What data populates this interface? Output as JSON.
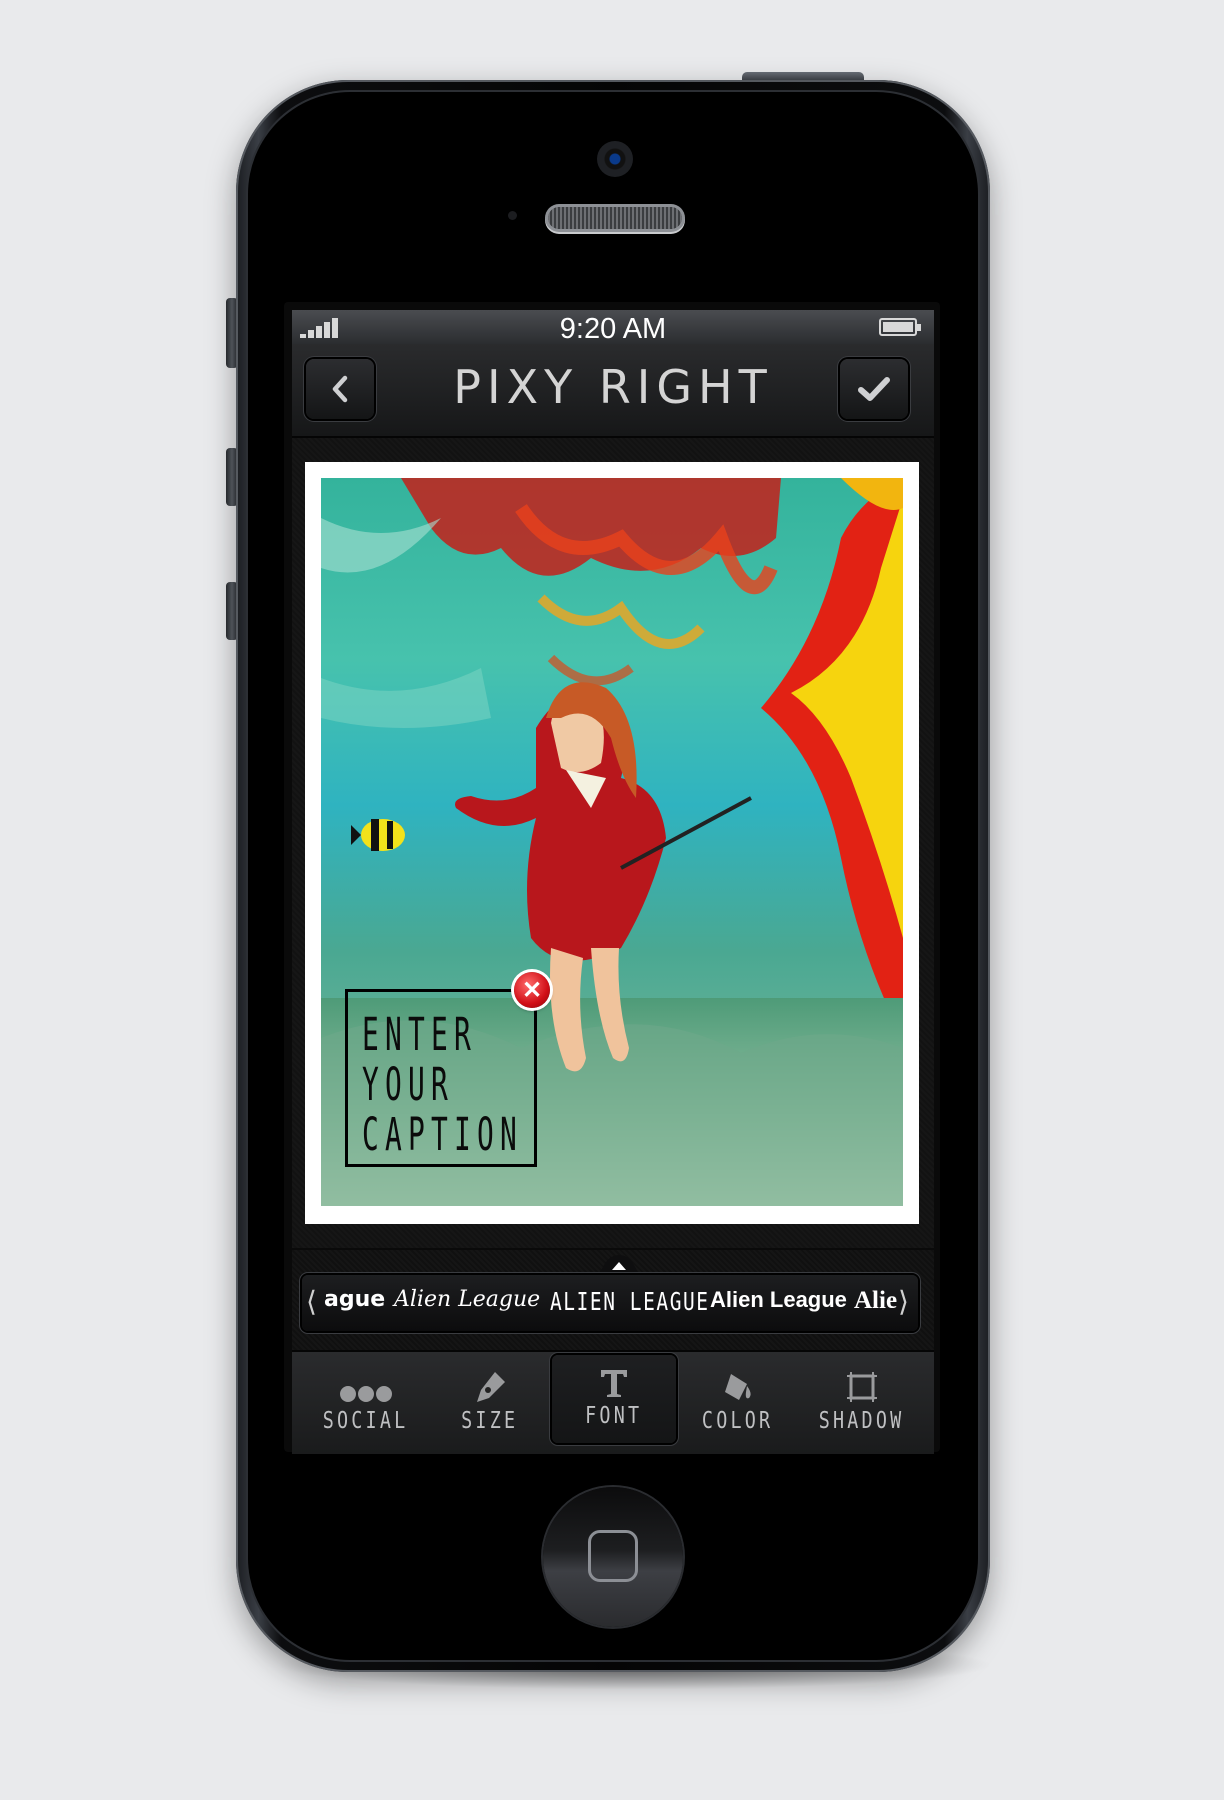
{
  "status_bar": {
    "time": "9:20 AM"
  },
  "nav": {
    "title": "PIXY RIGHT",
    "back_icon": "chevron-left-icon",
    "confirm_icon": "checkmark-icon"
  },
  "caption": {
    "text": "ENTER\nYOUR\nCAPTION",
    "close_icon": "close-icon"
  },
  "font_strip": {
    "items": [
      {
        "label": "ague",
        "style": "bubble"
      },
      {
        "label": "Alien League",
        "style": "script"
      },
      {
        "label": "ALIEN LEAGUE",
        "style": "condensed"
      },
      {
        "label": "Alien League",
        "style": "bold"
      },
      {
        "label": "Alie",
        "style": "serif"
      }
    ]
  },
  "toolbar": {
    "items": [
      {
        "label": "SOCIAL",
        "icon": "more-dots-icon"
      },
      {
        "label": "SIZE",
        "icon": "pen-nib-icon"
      },
      {
        "label": "FONT",
        "icon": "text-t-icon",
        "active": true
      },
      {
        "label": "COLOR",
        "icon": "paint-bucket-icon"
      },
      {
        "label": "SHADOW",
        "icon": "frame-icon"
      }
    ]
  },
  "colors": {
    "accent_red": "#d10f17",
    "toolbar": "#222326",
    "screen": "#0a0a0a"
  }
}
